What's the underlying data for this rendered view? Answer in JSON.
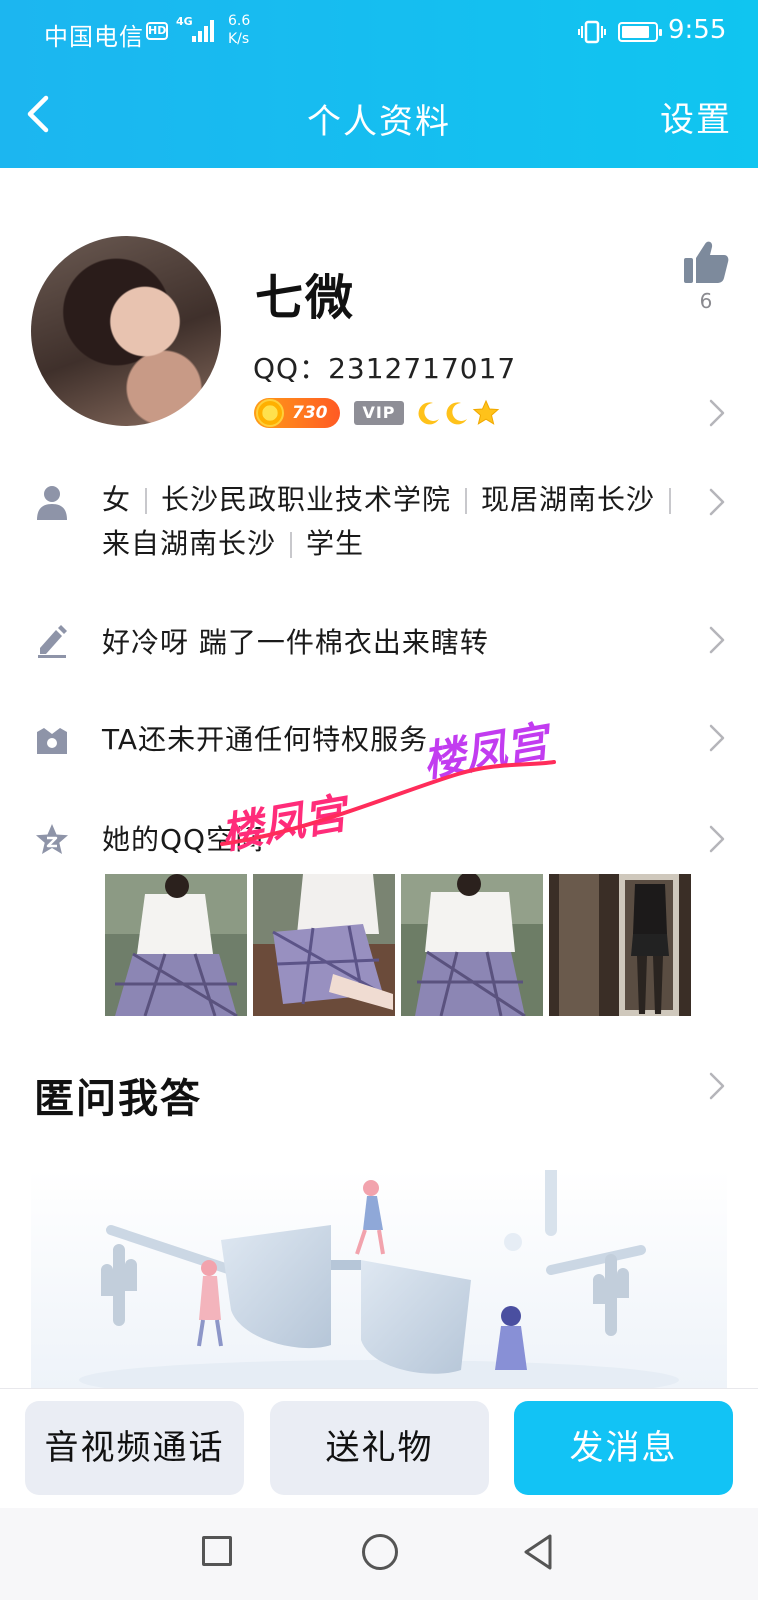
{
  "status_bar": {
    "carrier": "中国电信",
    "hd_label": "HD",
    "network_generation": "4G",
    "net_speed_value": "6.6",
    "net_speed_unit": "K/s",
    "battery_level": 0.85,
    "time": "9:55"
  },
  "header": {
    "title": "个人资料",
    "settings_label": "设置",
    "back_icon": "chevron-left-icon"
  },
  "profile": {
    "nickname": "七微",
    "qq_label": "QQ：",
    "qq_number": "2312717017",
    "level_value": "730",
    "vip_label": "VIP",
    "level_icons": [
      "moon",
      "moon",
      "star"
    ],
    "likes": "6"
  },
  "info": {
    "items": [
      "女",
      "长沙民政职业技术学院",
      "现居湖南长沙",
      "来自湖南长沙",
      "学生"
    ]
  },
  "signature": "好冷呀 踹了一件棉衣出来瞎转",
  "privilege": "TA还未开通任何特权服务",
  "qzone": {
    "label": "她的QQ空间",
    "photos": [
      "photo-school-uniform-1",
      "photo-school-uniform-2",
      "photo-school-uniform-3",
      "photo-mirror"
    ]
  },
  "qa_section": {
    "title": "匿问我答"
  },
  "watermark": {
    "text_1": "楼凤宫",
    "text_2": "楼凤宫"
  },
  "actions": {
    "call_label": "音视频通话",
    "gift_label": "送礼物",
    "message_label": "发消息"
  },
  "colors": {
    "header": "#1cb6f0",
    "primary_button": "#12c3f5",
    "secondary_button": "#eaedf4",
    "level_badge": "#ff7a1f",
    "watermark": "#ff2c7a"
  }
}
